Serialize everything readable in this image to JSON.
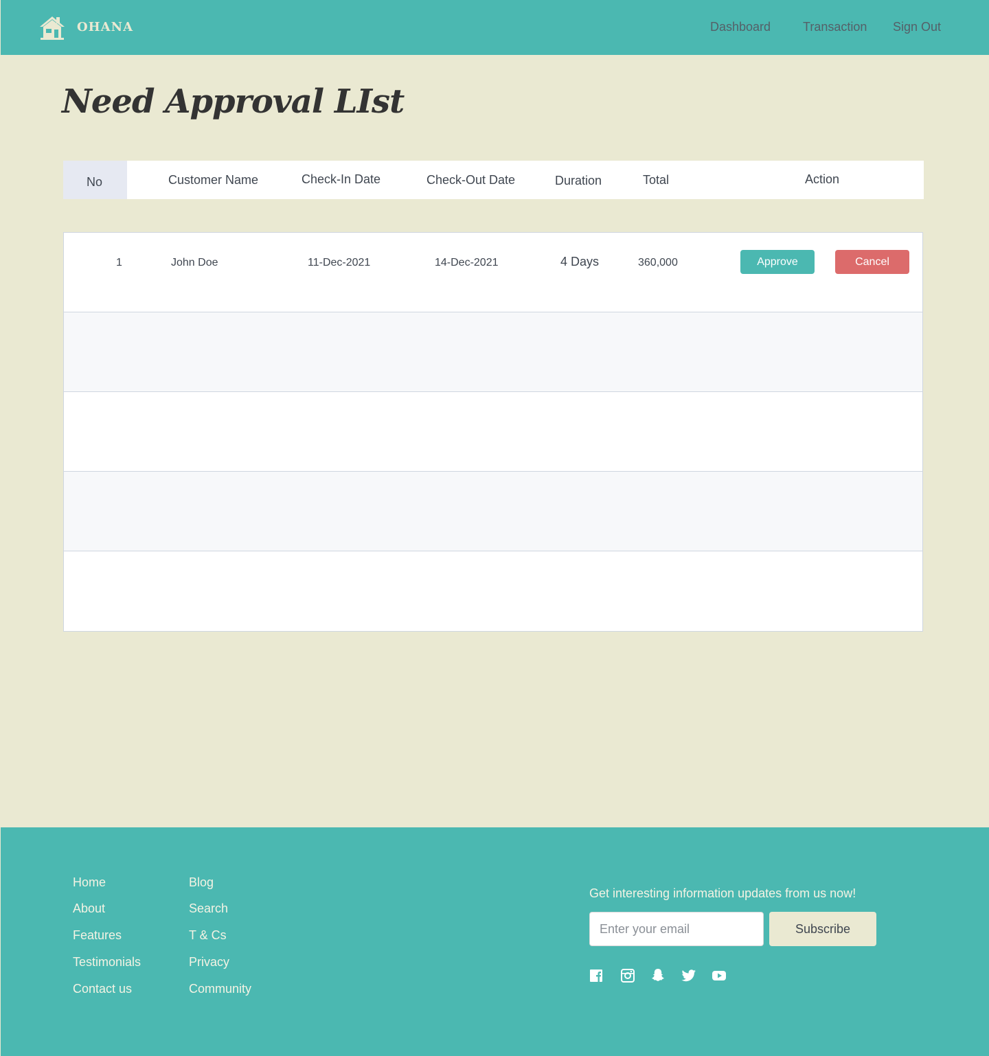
{
  "header": {
    "brand": "OHANA",
    "nav": {
      "dashboard": "Dashboard",
      "transaction": "Transaction",
      "sign_out": "Sign Out"
    }
  },
  "page": {
    "title": "Need Approval LIst"
  },
  "table": {
    "columns": {
      "no": "No",
      "customer_name": "Customer Name",
      "check_in": "Check-In Date",
      "check_out": "Check-Out Date",
      "duration": "Duration",
      "total": "Total",
      "action": "Action"
    },
    "rows": [
      {
        "no": "1",
        "customer_name": "John Doe",
        "check_in": "11-Dec-2021",
        "check_out": "14-Dec-2021",
        "duration": "4 Days",
        "total": "360,000",
        "approve_label": "Approve",
        "cancel_label": "Cancel"
      }
    ]
  },
  "footer": {
    "links_col1": [
      "Home",
      "About",
      "Features",
      "Testimonials",
      "Contact us"
    ],
    "links_col2": [
      "Blog",
      "Search",
      "T & Cs",
      "Privacy",
      "Community"
    ],
    "newsletter_text": "Get interesting information updates from us now!",
    "email_placeholder": "Enter your email",
    "subscribe_label": "Subscribe",
    "social_icons": [
      "facebook-icon",
      "instagram-icon",
      "snapchat-icon",
      "twitter-icon",
      "youtube-icon"
    ]
  },
  "colors": {
    "primary": "#4bb8b1",
    "background": "#eae9d2",
    "danger": "#dc6b6b"
  }
}
